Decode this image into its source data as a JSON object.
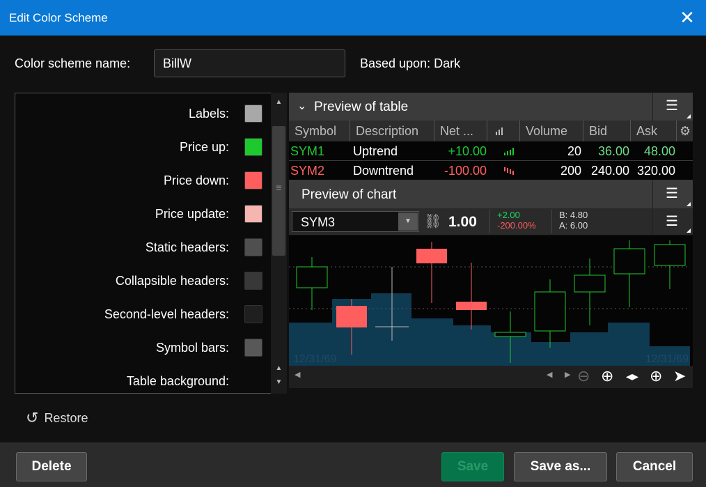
{
  "window": {
    "title": "Edit Color Scheme"
  },
  "form": {
    "name_label": "Color scheme name:",
    "name_value": "BillW",
    "based_upon": "Based upon: Dark"
  },
  "colors": [
    {
      "label": "Labels:",
      "color": "#a8a8a8"
    },
    {
      "label": "Price up:",
      "color": "#1ec930"
    },
    {
      "label": "Price down:",
      "color": "#ff5e5e"
    },
    {
      "label": "Price update:",
      "color": "#f5b5b0"
    },
    {
      "label": "Static headers:",
      "color": "#4f4f4f"
    },
    {
      "label": "Collapsible headers:",
      "color": "#383838"
    },
    {
      "label": "Second-level headers:",
      "color": "#1f1f1f"
    },
    {
      "label": "Symbol bars:",
      "color": "#585858"
    },
    {
      "label": "Table background:",
      "color": "#111111"
    }
  ],
  "table_preview": {
    "header": "Preview of table",
    "columns": [
      "Symbol",
      "Description",
      "Net ...",
      "Volume",
      "Bid",
      "Ask"
    ],
    "rows": [
      {
        "symbol": "SYM1",
        "description": "Uptrend",
        "net": "+10.00",
        "volume": "20",
        "bid": "36.00",
        "ask": "48.00",
        "dir": "up"
      },
      {
        "symbol": "SYM2",
        "description": "Downtrend",
        "net": "-100.00",
        "volume": "200",
        "bid": "240.00",
        "ask": "320.00",
        "dir": "down"
      }
    ]
  },
  "chart_preview": {
    "header": "Preview of chart",
    "symbol": "SYM3",
    "last": "1.00",
    "change": "+2.00",
    "change_pct": "-200.00%",
    "bid": "B: 4.80",
    "ask": "A: 6.00",
    "date_left": "12/31/69",
    "date_right": "12/31/69"
  },
  "actions": {
    "restore": "Restore",
    "delete": "Delete",
    "save": "Save",
    "save_as": "Save as...",
    "cancel": "Cancel"
  },
  "theme": {
    "titlebar": "#0a78d4",
    "up": "#1ec930",
    "down": "#ff5e5e",
    "volume": "#0e3a52"
  },
  "icons": [
    "close-icon",
    "chevron-down-icon",
    "menu-icon",
    "link-icon",
    "zoom-out-icon",
    "zoom-in-icon",
    "pan-icon",
    "crosshair-icon",
    "cursor-icon",
    "restore-icon"
  ]
}
